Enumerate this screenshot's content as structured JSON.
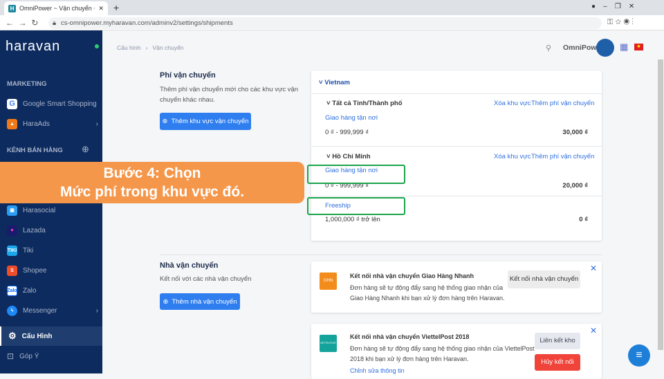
{
  "browser": {
    "tab_title": "OmniPower ~ Vận chuyển ~ Hara",
    "url": "cs-omnipower.myharavan.com/adminv2/settings/shipments"
  },
  "sidebar": {
    "logo": "haravan",
    "marketing_header": "MARKETING",
    "marketing": [
      {
        "label": "Google Smart Shopping"
      },
      {
        "label": "HaraAds"
      }
    ],
    "channels_header": "KÊNH BÁN HÀNG",
    "channels": [
      {
        "label": "Harasocial"
      },
      {
        "label": "Lazada"
      },
      {
        "label": "Tiki"
      },
      {
        "label": "Shopee"
      },
      {
        "label": "Zalo"
      },
      {
        "label": "Messenger"
      }
    ],
    "settings": "Cấu Hình",
    "feedback": "Góp Ý"
  },
  "header": {
    "breadcrumb": [
      "Cấu hình",
      "Vận chuyển"
    ],
    "store": "OmniPower"
  },
  "fees": {
    "title": "Phí vận chuyển",
    "desc": "Thêm phí vận chuyển mới cho các khu vực vận chuyển khác nhau.",
    "button": "Thêm khu vực vận chuyển",
    "country": "Vietnam",
    "zones": [
      {
        "name": "Tất cả Tỉnh/Thành phố",
        "delete": "Xóa khu vực",
        "add": "Thêm phí vận chuyển",
        "rates": [
          {
            "name": "Giao hàng tận nơi",
            "range": "0 ₫ - 999,999 ₫",
            "price": "30,000 ₫"
          }
        ]
      },
      {
        "name": "Hồ Chí Minh",
        "delete": "Xóa khu vực",
        "add": "Thêm phí vận chuyển",
        "rates": [
          {
            "name": "Giao hàng tận nơi",
            "range": "0 ₫ - 999,999 ₫",
            "price": "20,000 ₫"
          },
          {
            "name": "Freeship",
            "range": "1,000,000 ₫ trở lên",
            "price": "0 ₫"
          }
        ]
      }
    ]
  },
  "carriers": {
    "title": "Nhà vận chuyển",
    "desc": "Kết nối với các nhà vận chuyển",
    "button": "Thêm nhà vận chuyển",
    "items": [
      {
        "logo": "GHN",
        "title": "Kết nối nhà vận chuyển Giao Hàng Nhanh",
        "desc": "Đơn hàng sẽ tự động đẩy sang hệ thống giao nhận của Giao Hàng Nhanh khi bạn xử lý đơn hàng trên Haravan.",
        "button": "Kết nối nhà vận chuyển"
      },
      {
        "logo": "VIETTELPOST",
        "title": "Kết nối nhà vận chuyển ViettelPost 2018",
        "desc": "Đơn hàng sẽ tự động đẩy sang hệ thống giao nhận của ViettelPost 2018 khi bạn xử lý đơn hàng trên Haravan.",
        "button": "Liên kết kho",
        "button2": "Hủy kết nối",
        "link": "Chỉnh sửa thông tin"
      }
    ]
  },
  "overlay": {
    "line1": "Bước 4: Chọn",
    "line2": "Mức phí trong khu vực đó."
  }
}
